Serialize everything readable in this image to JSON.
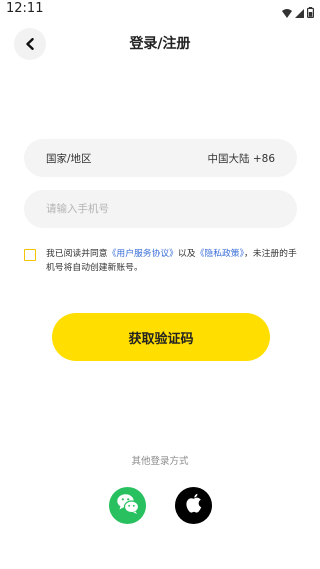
{
  "status_bar": {
    "time": "12:11"
  },
  "header": {
    "title": "登录/注册"
  },
  "region": {
    "label": "国家/地区",
    "value": "中国大陆 +86"
  },
  "phone": {
    "value": "",
    "placeholder": "请输入手机号"
  },
  "agreement": {
    "checked": false,
    "prefix": "我已阅读并同意",
    "user_agreement": "《用户服务协议》",
    "and": "以及",
    "privacy_policy": "《隐私政策》",
    "suffix": "，未注册的手机号将自动创建新账号。"
  },
  "primary_button": {
    "label": "获取验证码"
  },
  "other_login": {
    "label": "其他登录方式",
    "options": [
      "wechat-icon",
      "apple-icon"
    ]
  },
  "colors": {
    "accent": "#ffde00",
    "link": "#3a6fd8",
    "checkbox_border": "#f2c400",
    "wechat": "#29c160",
    "apple": "#000000",
    "field_bg": "#f4f4f4"
  }
}
